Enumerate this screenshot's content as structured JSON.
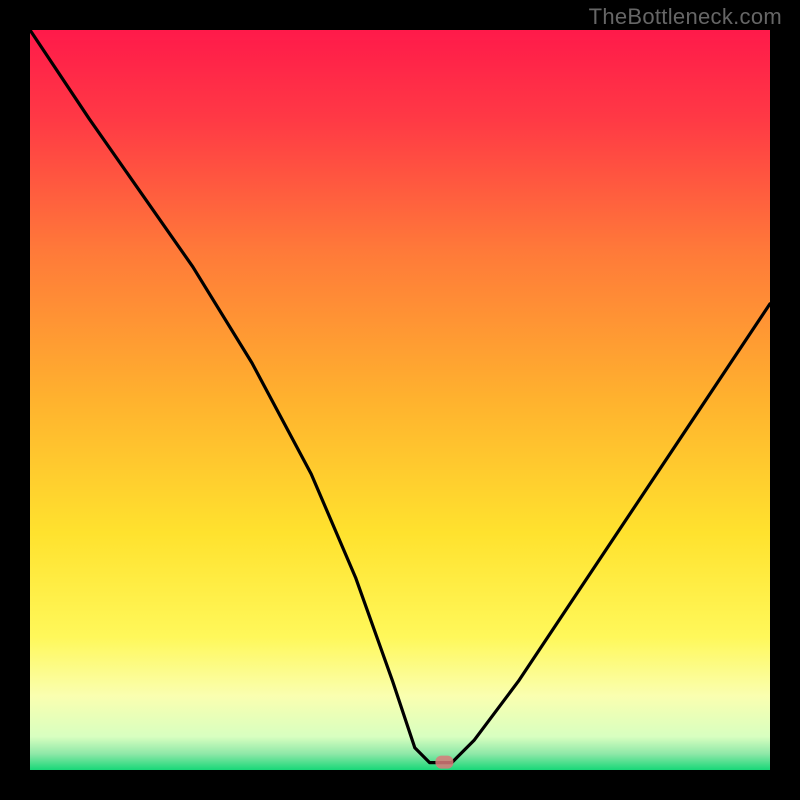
{
  "watermark": "TheBottleneck.com",
  "chart_data": {
    "type": "line",
    "title": "",
    "xlabel": "",
    "ylabel": "",
    "xlim": [
      0,
      100
    ],
    "ylim": [
      0,
      100
    ],
    "annotations": [],
    "series": [
      {
        "name": "bottleneck-curve",
        "x": [
          0,
          8,
          15,
          22,
          30,
          38,
          44,
          49,
          52,
          54,
          57,
          60,
          66,
          74,
          82,
          90,
          100
        ],
        "values": [
          100,
          88,
          78,
          68,
          55,
          40,
          26,
          12,
          3,
          1,
          1,
          4,
          12,
          24,
          36,
          48,
          63
        ]
      }
    ],
    "marker": {
      "x": 56,
      "y": 1
    },
    "background": {
      "type": "vertical-gradient",
      "stops": [
        {
          "pos": 0.0,
          "color": "#ff1a4a"
        },
        {
          "pos": 0.12,
          "color": "#ff3945"
        },
        {
          "pos": 0.3,
          "color": "#ff7a39"
        },
        {
          "pos": 0.5,
          "color": "#ffb22e"
        },
        {
          "pos": 0.68,
          "color": "#ffe22e"
        },
        {
          "pos": 0.82,
          "color": "#fff85a"
        },
        {
          "pos": 0.9,
          "color": "#faffb0"
        },
        {
          "pos": 0.955,
          "color": "#d8ffc0"
        },
        {
          "pos": 0.978,
          "color": "#8fe8a8"
        },
        {
          "pos": 1.0,
          "color": "#18d878"
        }
      ]
    }
  }
}
